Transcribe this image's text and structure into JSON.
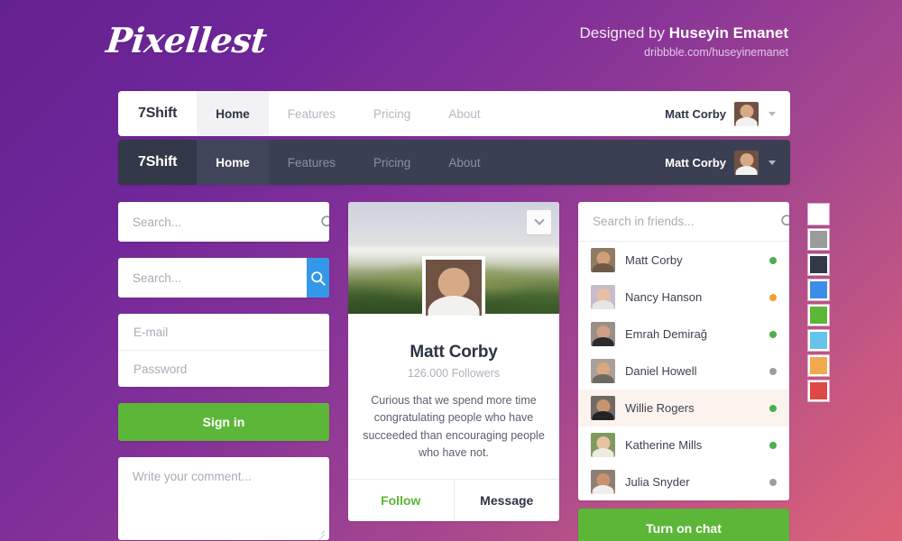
{
  "header": {
    "logo": "Pixellest",
    "credit_prefix": "Designed by ",
    "credit_name": "Huseyin Emanet",
    "credit_url": "dribbble.com/huseyinemanet"
  },
  "navbars": [
    {
      "theme": "light",
      "brand": "7Shift",
      "items": [
        "Home",
        "Features",
        "Pricing",
        "About"
      ],
      "active_item": "Home",
      "user": "Matt Corby"
    },
    {
      "theme": "dark",
      "brand": "7Shift",
      "items": [
        "Home",
        "Features",
        "Pricing",
        "About"
      ],
      "active_item": "Home",
      "user": "Matt Corby"
    }
  ],
  "left_column": {
    "search_plain_placeholder": "Search...",
    "search_button_placeholder": "Search...",
    "search_icon": "search-icon",
    "email_placeholder": "E-mail",
    "password_placeholder": "Password",
    "signin_label": "Sign in",
    "comment_placeholder": "Write your comment..."
  },
  "profile": {
    "cover_toggle_icon": "chevron-down-icon",
    "name": "Matt Corby",
    "followers": "126.000 Followers",
    "bio": "Curious that we spend more time congratulating people who have succeeded than encouraging people who have not.",
    "follow_label": "Follow",
    "message_label": "Message"
  },
  "friends": {
    "search_placeholder": "Search in friends...",
    "search_icon": "search-icon",
    "chat_button_label": "Turn on chat",
    "list": [
      {
        "name": "Matt Corby",
        "status": "online",
        "status_color": "#4caf50",
        "avatar": "av-matt",
        "hovered": false
      },
      {
        "name": "Nancy Hanson",
        "status": "away",
        "status_color": "#f0a030",
        "avatar": "av-nancy",
        "hovered": false
      },
      {
        "name": "Emrah Demirağ",
        "status": "online",
        "status_color": "#4caf50",
        "avatar": "av-emrah",
        "hovered": false
      },
      {
        "name": "Daniel Howell",
        "status": "offline",
        "status_color": "#9e9e9e",
        "avatar": "av-daniel",
        "hovered": false
      },
      {
        "name": "Willie Rogers",
        "status": "online",
        "status_color": "#4caf50",
        "avatar": "av-willie",
        "hovered": true
      },
      {
        "name": "Katherine Mills",
        "status": "online",
        "status_color": "#4caf50",
        "avatar": "av-kath",
        "hovered": false
      },
      {
        "name": "Julia Snyder",
        "status": "offline",
        "status_color": "#9e9e9e",
        "avatar": "av-julia",
        "hovered": false
      }
    ]
  },
  "swatches": [
    {
      "name": "white",
      "hex": "#ffffff"
    },
    {
      "name": "gray",
      "hex": "#9b9b9b"
    },
    {
      "name": "dark-navy",
      "hex": "#333848"
    },
    {
      "name": "blue",
      "hex": "#3b8ee8"
    },
    {
      "name": "green",
      "hex": "#5cb638"
    },
    {
      "name": "light-blue",
      "hex": "#66c4ea"
    },
    {
      "name": "orange",
      "hex": "#f0a94e"
    },
    {
      "name": "red",
      "hex": "#de4848"
    }
  ],
  "theme": {
    "bg_purple": "#64228f",
    "bg_pink": "#dc6277",
    "accent_green": "#5cb638",
    "accent_blue": "#3498e8",
    "dark_nav": "#3a3f51"
  }
}
